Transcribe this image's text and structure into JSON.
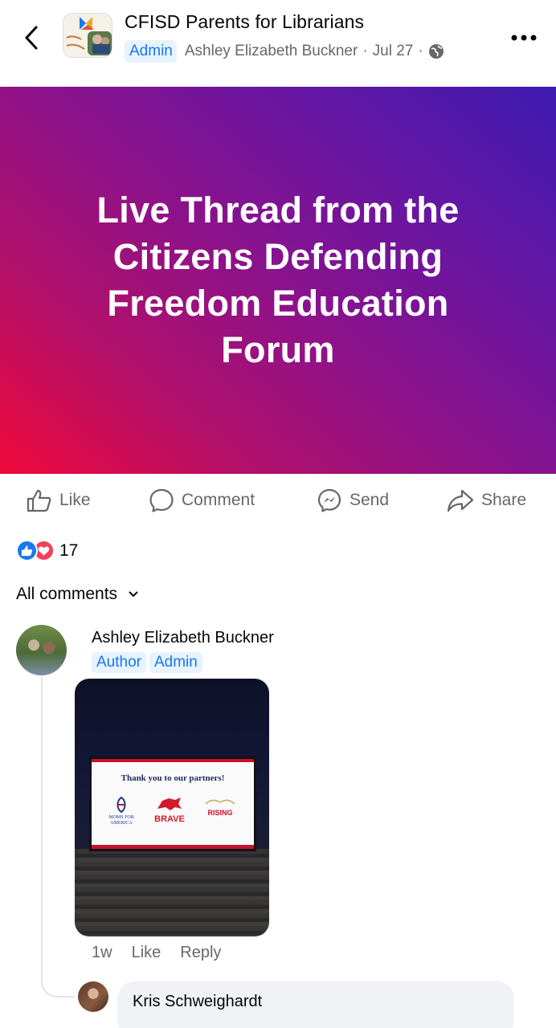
{
  "header": {
    "group_name": "CFISD Parents for Librarians",
    "role_badge": "Admin",
    "author": "Ashley Elizabeth Buckner",
    "date": "Jul 27",
    "separator": "·",
    "privacy_icon": "globe-icon",
    "back_icon": "chevron-left-icon",
    "more_icon": "more-horizontal-icon"
  },
  "post": {
    "banner_text": "Live Thread from the Citizens Defending Freedom Education Forum",
    "banner_colors": [
      "#f0083a",
      "#8a128c",
      "#3d1bb0"
    ]
  },
  "actions": {
    "like": "Like",
    "comment": "Comment",
    "send": "Send",
    "share": "Share"
  },
  "reactions": {
    "types": [
      "like",
      "love"
    ],
    "count": "17"
  },
  "comments_filter": {
    "label": "All comments"
  },
  "comments": [
    {
      "author": "Ashley Elizabeth Buckner",
      "badges": [
        "Author",
        "Admin"
      ],
      "photo": {
        "screen_title": "Thank you to our partners!",
        "partners": [
          "MOMS FOR AMERICA",
          "BRAVE",
          "RISING"
        ]
      },
      "time": "1w",
      "like": "Like",
      "reply": "Reply"
    }
  ],
  "reply": {
    "author": "Kris Schweighardt"
  },
  "colors": {
    "accent": "#1877f2",
    "love": "#f33e58",
    "muted_text": "#65676b",
    "badge_bg": "#e7f3ff"
  }
}
